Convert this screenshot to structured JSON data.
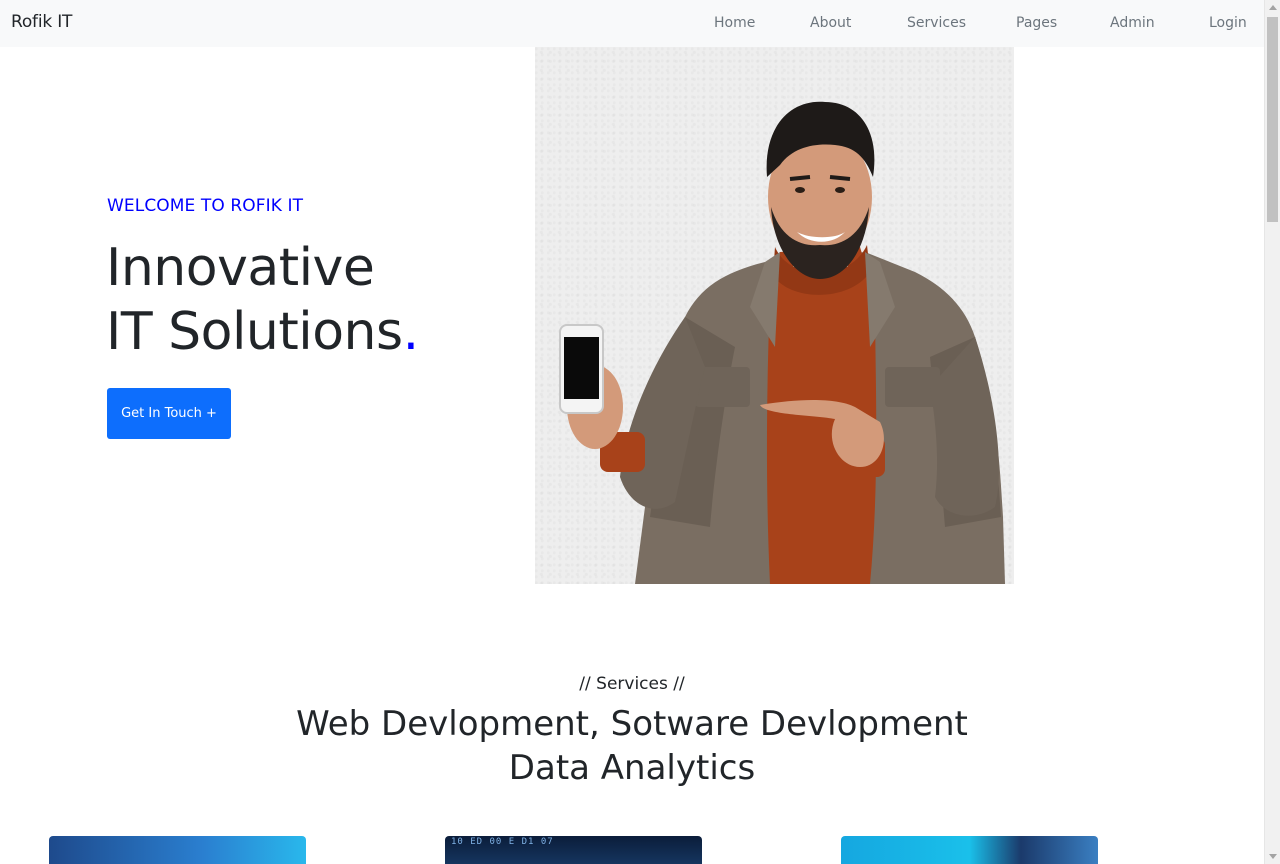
{
  "navbar": {
    "brand": "Rofik IT",
    "links": [
      "Home",
      "About",
      "Services",
      "Pages",
      "Admin",
      "Login"
    ]
  },
  "hero": {
    "eyebrow": "WELCOME TO ROFIK IT",
    "title_line1": "Innovative",
    "title_line2": "IT Solutions",
    "title_dot": ".",
    "cta_label": "Get In Touch +",
    "image_alt": "Smiling man in brown jacket holding a smartphone and pointing at it"
  },
  "services": {
    "eyebrow": "// Services //",
    "title_line1": "Web Devlopment, Sotware Devlopment",
    "title_line2": "Data Analytics",
    "card_2_text": "10 ED 00 E D1 07"
  },
  "colors": {
    "accent_blue": "#0000ff",
    "button_blue": "#0d6efd",
    "navbar_bg": "#f8f9fa"
  }
}
